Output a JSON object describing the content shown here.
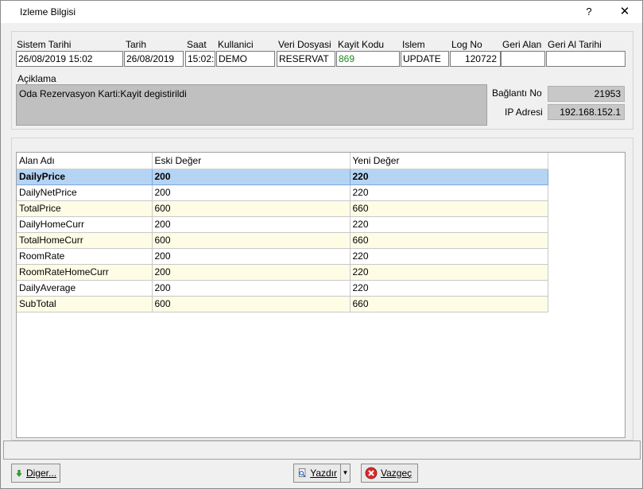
{
  "window": {
    "title": "Izleme Bilgisi",
    "help": "?",
    "close": "✕"
  },
  "info": {
    "labels": {
      "sistem_tarihi": "Sistem Tarihi",
      "tarih": "Tarih",
      "saat": "Saat",
      "kullanici": "Kullanici",
      "veri_dosyasi": "Veri Dosyasi",
      "kayit_kodu": "Kayit Kodu",
      "islem": "Islem",
      "log_no": "Log No",
      "geri_alan": "Geri Alan",
      "geri_al_tarihi": "Geri Al Tarihi",
      "aciklama": "Açiklama",
      "baglanti_no": "Bağlantı No",
      "ip_adresi": "IP Adresi"
    },
    "values": {
      "sistem_tarihi": "26/08/2019 15:02",
      "tarih": "26/08/2019",
      "saat": "15:02:",
      "kullanici": "DEMO",
      "veri_dosyasi": "RESERVAT",
      "kayit_kodu": "869",
      "islem": "UPDATE",
      "log_no": "120722",
      "geri_alan": "",
      "geri_al_tarihi": "",
      "aciklama": "Oda Rezervasyon Karti:Kayit degistirildi",
      "baglanti_no": "21953",
      "ip_adresi": "192.168.152.1"
    }
  },
  "grid": {
    "columns": [
      "Alan Adı",
      "Eski Değer",
      "Yeni Değer"
    ],
    "rows": [
      [
        "DailyPrice",
        "200",
        "220"
      ],
      [
        "DailyNetPrice",
        "200",
        "220"
      ],
      [
        "TotalPrice",
        "600",
        "660"
      ],
      [
        "DailyHomeCurr",
        "200",
        "220"
      ],
      [
        "TotalHomeCurr",
        "600",
        "660"
      ],
      [
        "RoomRate",
        "200",
        "220"
      ],
      [
        "RoomRateHomeCurr",
        "200",
        "220"
      ],
      [
        "DailyAverage",
        "200",
        "220"
      ],
      [
        "SubTotal",
        "600",
        "660"
      ]
    ],
    "selected_row": 0
  },
  "buttons": {
    "diger": "Diger...",
    "yazdir": "Yazdır",
    "vazgec": "Vazgeç"
  },
  "colors": {
    "selected_row": "#b5d3f3",
    "alt_row": "#fffce6",
    "kayit_kodu_text": "#1a8a1a"
  }
}
